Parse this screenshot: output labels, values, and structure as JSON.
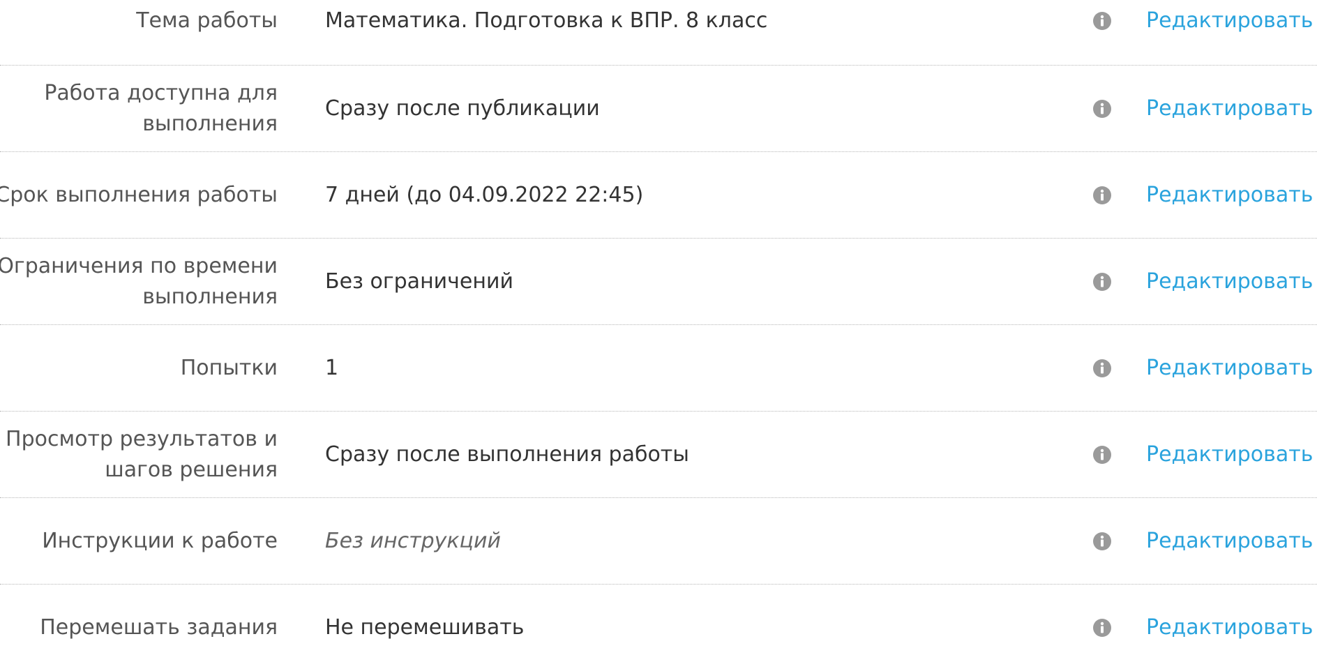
{
  "colors": {
    "label": "#555555",
    "value": "#333333",
    "link": "#2aa3dd",
    "info_icon": "#9a9a9a",
    "divider": "#b5b5b5"
  },
  "icons": {
    "info": "info-circle-icon"
  },
  "settings": [
    {
      "label": "Тема работы",
      "value": "Математика. Подготовка к ВПР. 8 класс",
      "edit": "Редактировать"
    },
    {
      "label": "Работа доступна для выполнения",
      "value": "Сразу после публикации",
      "edit": "Редактировать"
    },
    {
      "label": "Срок выполнения работы",
      "value": "7 дней (до 04.09.2022 22:45)",
      "edit": "Редактировать"
    },
    {
      "label": "Ограничения по времени выполнения",
      "value": "Без ограничений",
      "edit": "Редактировать"
    },
    {
      "label": "Попытки",
      "value": "1",
      "edit": "Редактировать"
    },
    {
      "label": "Просмотр результатов и шагов решения",
      "value": "Сразу после выполнения работы",
      "edit": "Редактировать"
    },
    {
      "label": "Инструкции к работе",
      "value": "Без инструкций",
      "edit": "Редактировать"
    },
    {
      "label": "Перемешать задания",
      "value": "Не перемешивать",
      "edit": "Редактировать"
    }
  ]
}
